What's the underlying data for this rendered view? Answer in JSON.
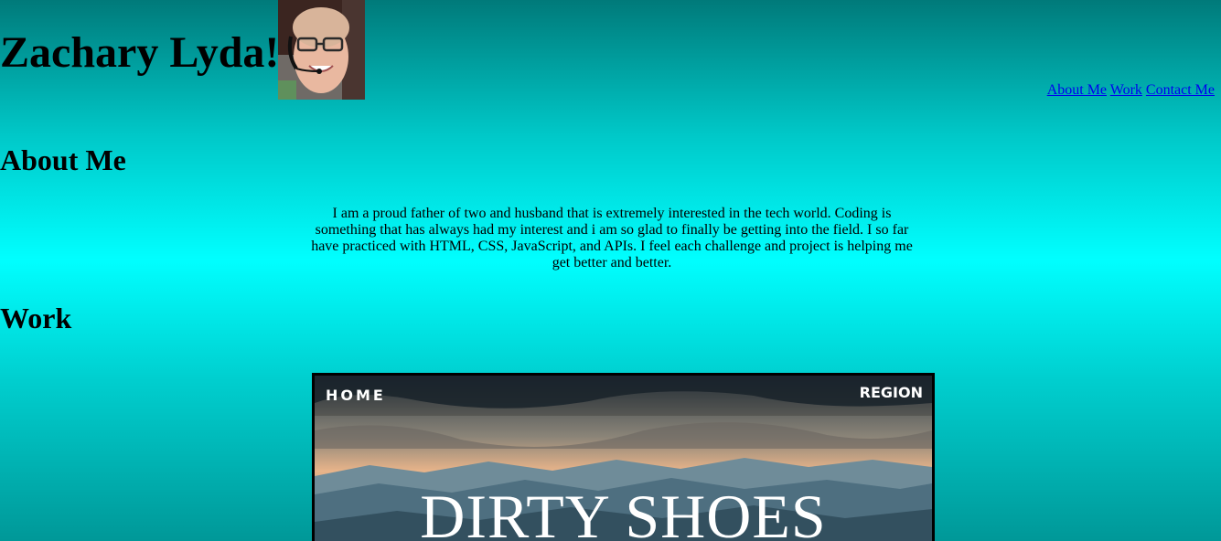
{
  "header": {
    "title": "Zachary Lyda!",
    "avatar_icon": "portrait-photo"
  },
  "nav": {
    "items": [
      {
        "label": "About Me"
      },
      {
        "label": "Work"
      },
      {
        "label": "Contact Me"
      }
    ],
    "link_color": "#0000ee"
  },
  "about": {
    "heading": "About Me",
    "text": "I am a proud father of two and husband that is extremely interested in the tech world. Coding is something that has always had my interest and i am so glad to finally be getting into the field. I so far have practiced with HTML, CSS, JavaScript, and APIs. I feel each challenge and project is helping me get better and better."
  },
  "work": {
    "heading": "Work",
    "projects": [
      {
        "nav_left": "HOME",
        "nav_right": "REGION",
        "title": "DIRTY SHOES"
      }
    ]
  },
  "colors": {
    "background_top": "#007a7a",
    "background_mid": "#00ffff",
    "background_bottom": "#009898"
  }
}
